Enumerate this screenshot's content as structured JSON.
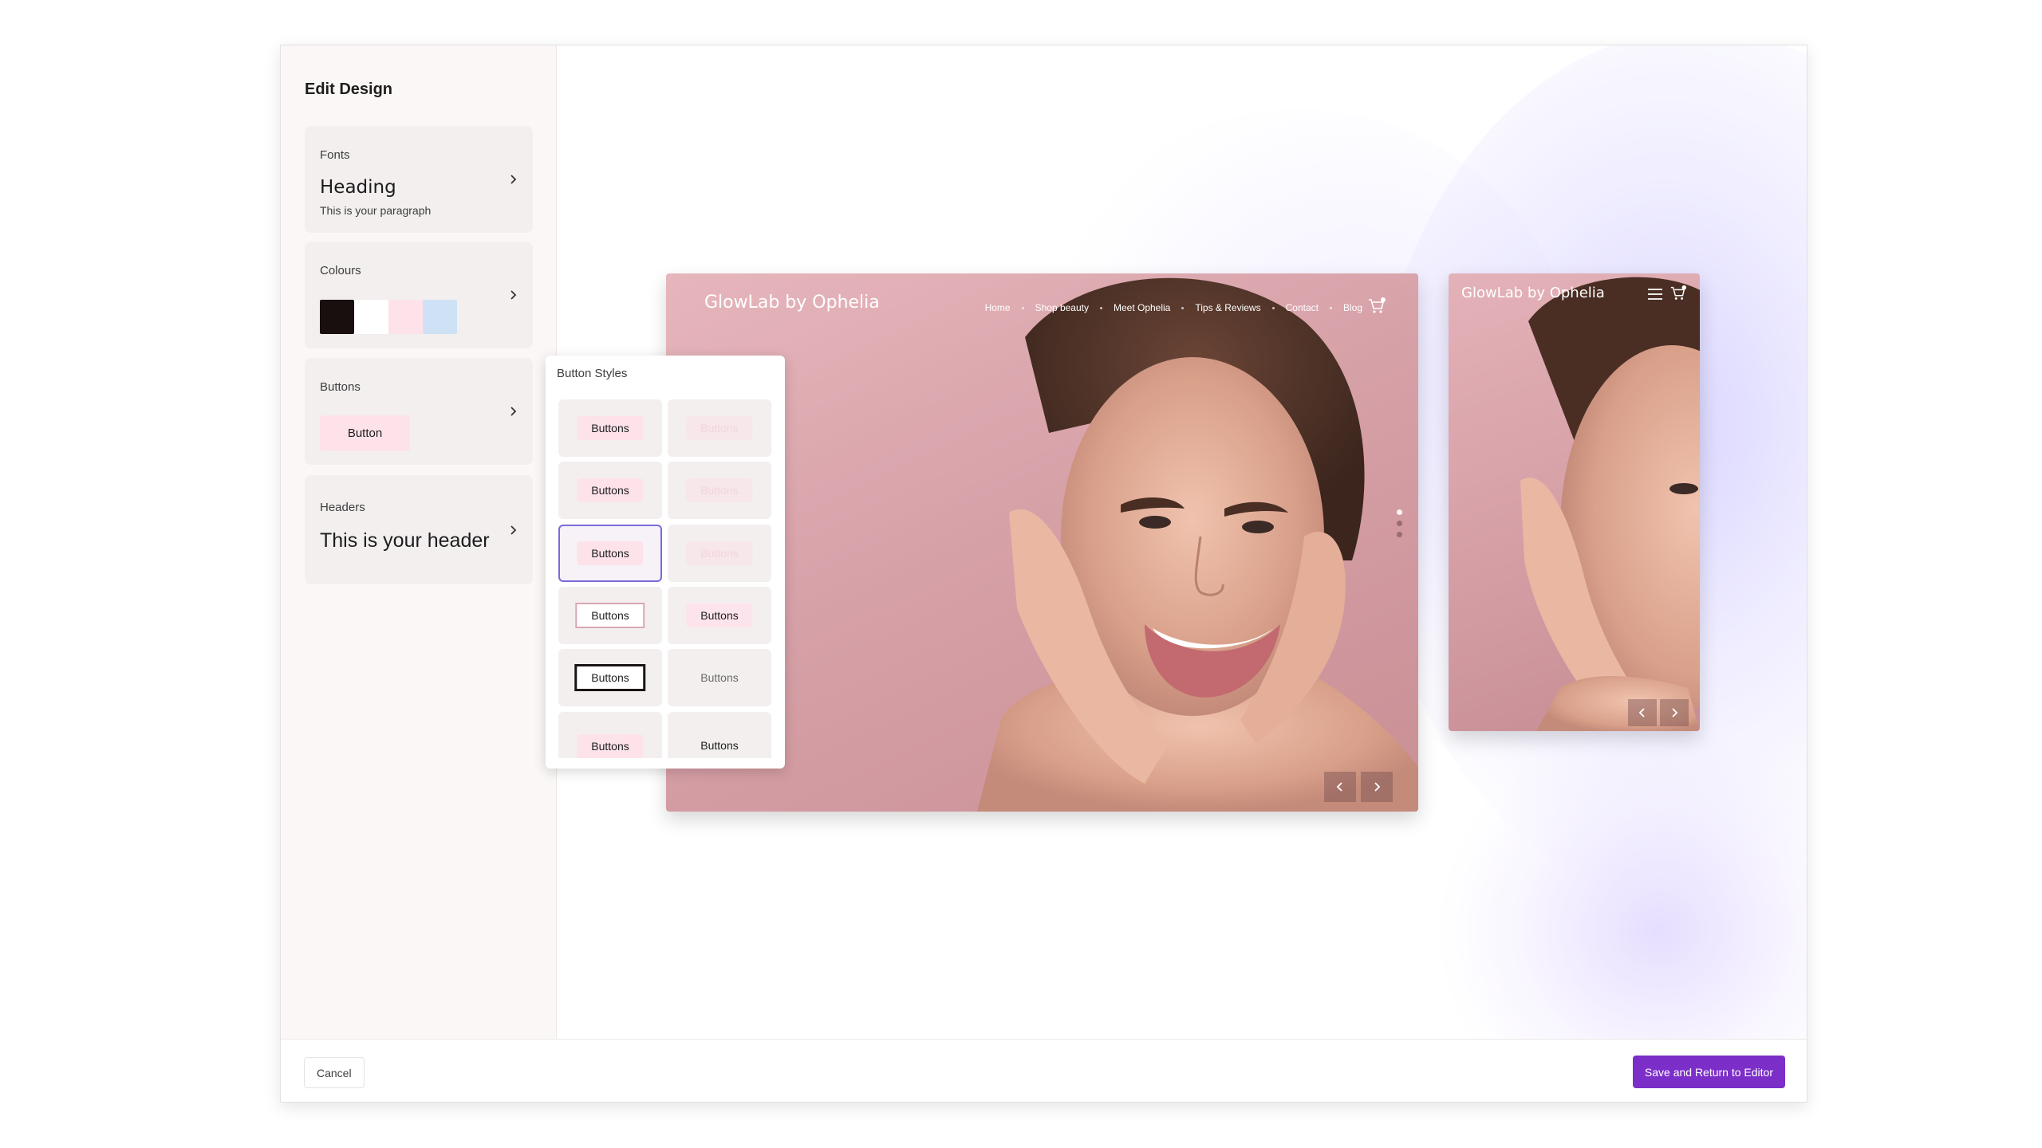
{
  "sidebar": {
    "title": "Edit Design",
    "fonts": {
      "label": "Fonts",
      "heading": "Heading",
      "paragraph": "This is your paragraph"
    },
    "colours": {
      "label": "Colours",
      "swatches": [
        "#1a0f0f",
        "#ffffff",
        "#fde2ea",
        "#cfe2f5"
      ]
    },
    "buttons": {
      "label": "Buttons",
      "sample": "Button"
    },
    "headers": {
      "label": "Headers",
      "sample": "This is your header"
    }
  },
  "popup": {
    "title": "Button Styles",
    "cells": [
      "Buttons",
      "Buttons",
      "Buttons",
      "Buttons",
      "Buttons",
      "Buttons",
      "Buttons",
      "Buttons",
      "Buttons",
      "Buttons",
      "Buttons",
      "Buttons"
    ]
  },
  "desktop": {
    "brand": "GlowLab by Ophelia",
    "nav": [
      "Home",
      "Shop beauty",
      "Meet Ophelia",
      "Tips & Reviews",
      "Contact",
      "Blog"
    ],
    "cart_count": "0"
  },
  "mobile": {
    "brand": "GlowLab by Ophelia",
    "cart_count": "0"
  },
  "footer": {
    "cancel": "Cancel",
    "save": "Save and Return to Editor"
  },
  "colors": {
    "accent": "#7c2ec9",
    "selected_border": "#7b6ad9",
    "button_pink": "#fde2ea"
  }
}
